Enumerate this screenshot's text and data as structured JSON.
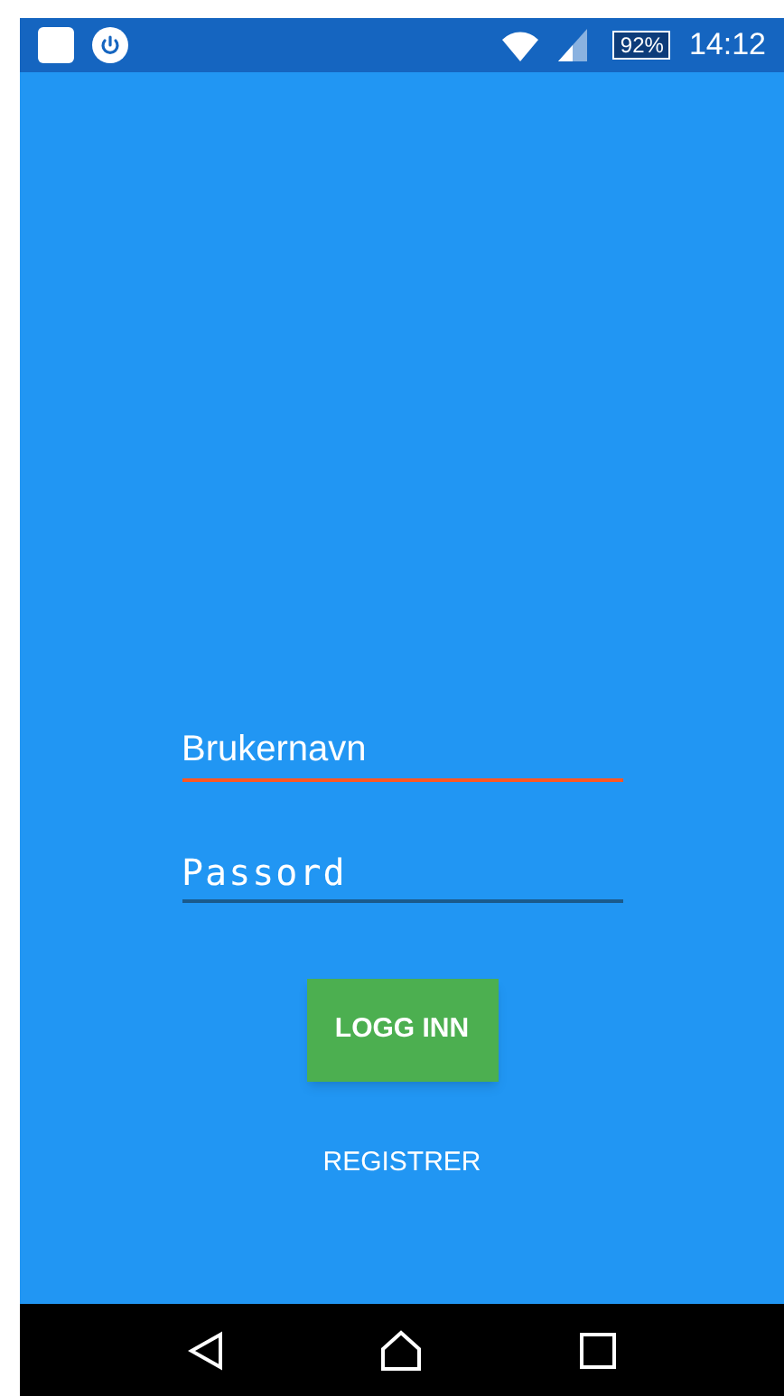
{
  "status_bar": {
    "battery": "92%",
    "time": "14:12"
  },
  "fields": [
    {
      "kind": "text",
      "placeholder": "Brukernavn",
      "focused": true
    },
    {
      "kind": "password",
      "placeholder": "Passord",
      "focused": false
    }
  ],
  "login_button": {
    "label": "LOGG INN"
  },
  "register_link": {
    "label": "REGISTRER"
  }
}
